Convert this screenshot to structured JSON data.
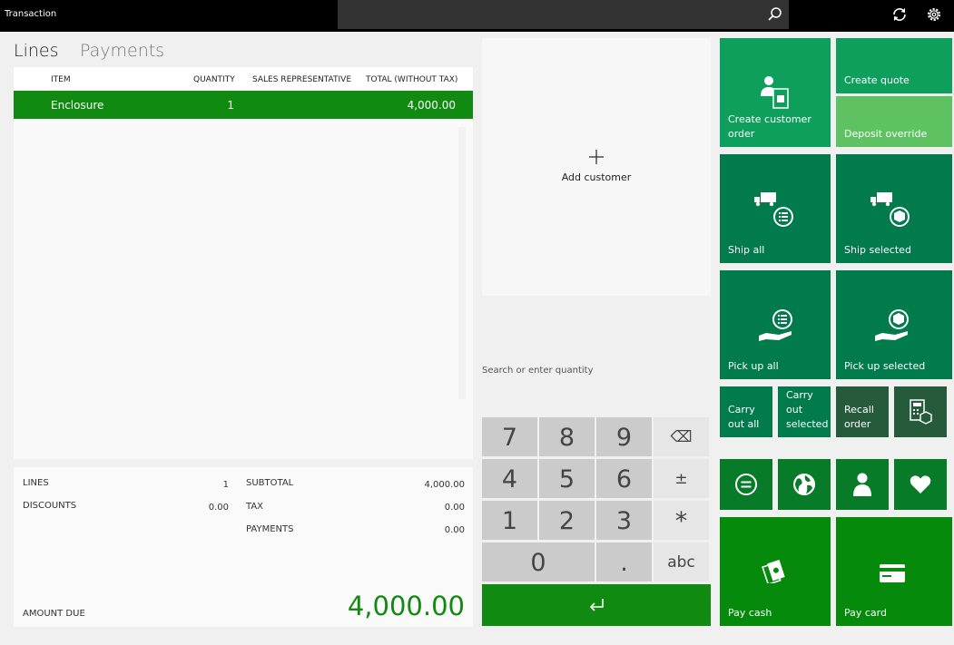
{
  "header": {
    "title": "Transaction"
  },
  "tabs": [
    {
      "label": "Lines"
    },
    {
      "label": "Payments"
    }
  ],
  "grid": {
    "columns": [
      "ITEM",
      "QUANTITY",
      "SALES REPRESENTATIVE",
      "TOTAL (WITHOUT TAX)"
    ],
    "rows": [
      {
        "item": "Enclosure",
        "quantity": "1",
        "sales_rep": "",
        "total": "4,000.00",
        "selected": true
      }
    ]
  },
  "totals": {
    "lines_label": "LINES",
    "lines_value": "1",
    "discounts_label": "DISCOUNTS",
    "discounts_value": "0.00",
    "subtotal_label": "SUBTOTAL",
    "subtotal_value": "4,000.00",
    "tax_label": "TAX",
    "tax_value": "0.00",
    "payments_label": "PAYMENTS",
    "payments_value": "0.00",
    "amount_due_label": "AMOUNT DUE",
    "amount_due_value": "4,000.00"
  },
  "customer": {
    "add_label": "Add customer"
  },
  "numpad": {
    "label": "Search or enter quantity",
    "keys": [
      "7",
      "8",
      "9",
      "⌫",
      "4",
      "5",
      "6",
      "±",
      "1",
      "2",
      "3",
      "*",
      "0",
      ".",
      "abc"
    ],
    "enter_icon": "enter-icon"
  },
  "tiles": {
    "create_customer_order": "Create customer order",
    "create_quote": "Create quote",
    "deposit_override": "Deposit override",
    "ship_all": "Ship all",
    "ship_selected": "Ship selected",
    "pick_up_all": "Pick up all",
    "pick_up_selected": "Pick up selected",
    "carry_out_all": "Carry out all",
    "carry_out_selected": "Carry out selected",
    "recall_order": "Recall order",
    "pay_cash": "Pay cash",
    "pay_card": "Pay card"
  },
  "icons": [
    "search-icon",
    "refresh-icon",
    "gear-icon",
    "calculator-icon",
    "equals-icon",
    "globe-icon",
    "customer-icon",
    "heart-icon",
    "cash-icon",
    "card-icon"
  ],
  "colors": {
    "accent": "#108a10",
    "tile_teal": "#017a4c",
    "tile_green": "#058a0b"
  }
}
